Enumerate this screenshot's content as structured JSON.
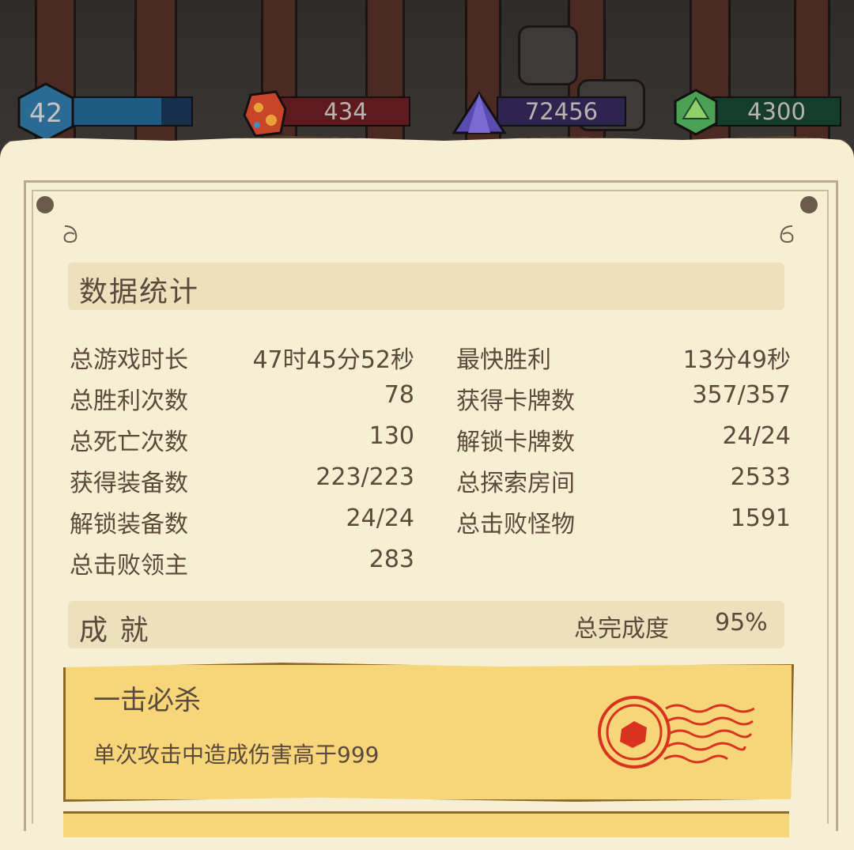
{
  "resources": {
    "level": "42",
    "red_gem": "434",
    "purple_crystal": "72456",
    "green_die": "4300"
  },
  "stats_section": {
    "title": "数据统计",
    "left": [
      {
        "label": "总游戏时长",
        "value": "47时45分52秒"
      },
      {
        "label": "总胜利次数",
        "value": "78"
      },
      {
        "label": "总死亡次数",
        "value": "130"
      },
      {
        "label": "获得装备数",
        "value": "223/223"
      },
      {
        "label": "解锁装备数",
        "value": "24/24"
      },
      {
        "label": "总击败领主",
        "value": "283"
      }
    ],
    "right": [
      {
        "label": "最快胜利",
        "value": "13分49秒"
      },
      {
        "label": "获得卡牌数",
        "value": "357/357"
      },
      {
        "label": "解锁卡牌数",
        "value": "24/24"
      },
      {
        "label": "总探索房间",
        "value": "2533"
      },
      {
        "label": "总击败怪物",
        "value": "1591"
      }
    ]
  },
  "achievements_section": {
    "title": "成 就",
    "completion_label": "总完成度",
    "completion_value": "95%",
    "completion_fraction": 0.95
  },
  "achievements": [
    {
      "name": "一击必杀",
      "description": "单次攻击中造成伤害高于999",
      "stamp_icon": "red-postmark-stamp-icon"
    }
  ],
  "colors": {
    "parchment": "#f7efd3",
    "section_bar": "#ede0bd",
    "text": "#5b4a3b",
    "level_bar": "#1f5a82",
    "red_bar": "#5e1a1c",
    "purple_bar": "#2e2450",
    "green_bar": "#143d2c",
    "achievement_card": "#f7d67a",
    "stamp": "#d9331f"
  }
}
